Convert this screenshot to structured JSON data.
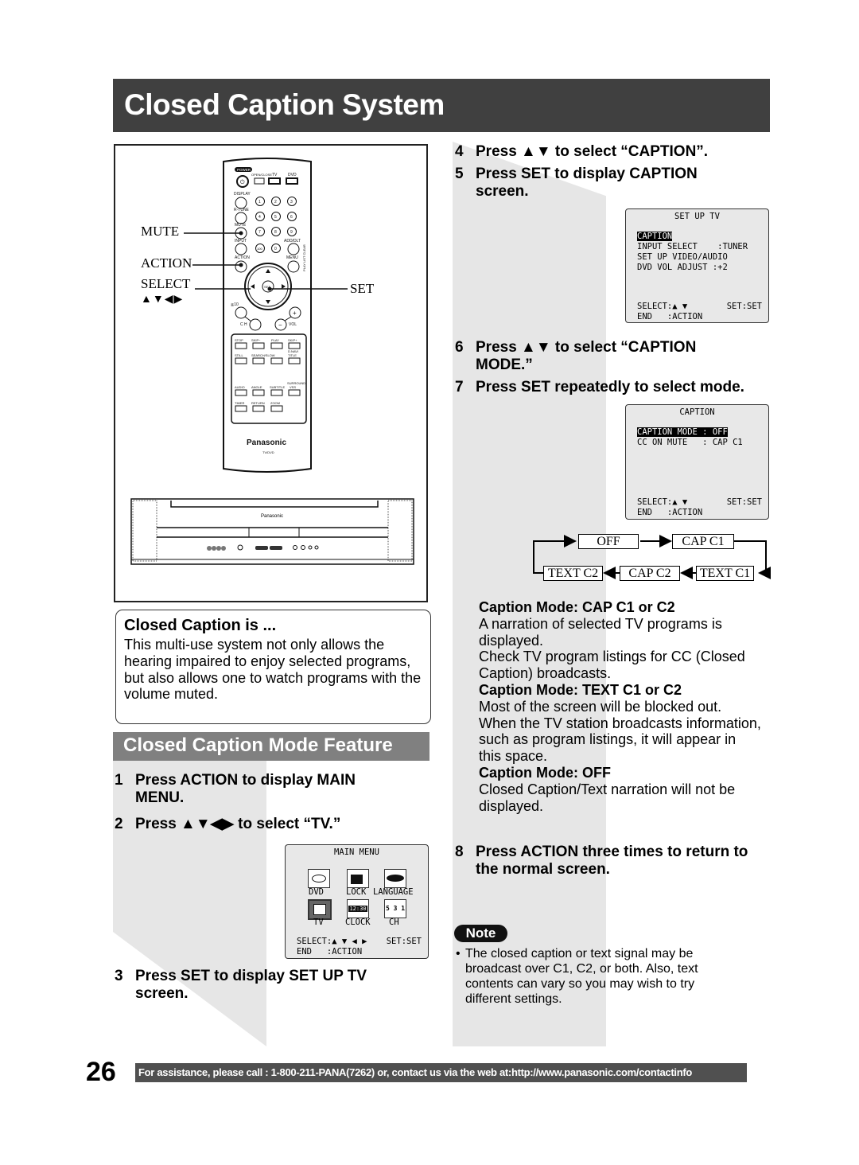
{
  "page": {
    "title": "Closed Caption System",
    "page_number": "26",
    "footer": "For assistance, please call : 1-800-211-PANA(7262) or, contact us via the web at:http://www.panasonic.com/contactinfo"
  },
  "remote": {
    "brand": "Panasonic",
    "model_label": "TV/DVD",
    "callouts": {
      "mute": "MUTE",
      "action": "ACTION",
      "select": "SELECT",
      "select_arrows": "▲▼◀▶",
      "set": "SET"
    },
    "button_labels": {
      "power": "POWER",
      "open_close": "OPEN/CLOSE",
      "tv": "TV",
      "dvd": "DVD",
      "display": "DISPLAY",
      "rtune": "R-TUNE",
      "mute": "MUTE",
      "input": "INPUT",
      "add_dlt": "ADD/DLT",
      "action": "ACTION",
      "menu": "MENU",
      "clear": "CLEAR",
      "play_list": "PLAY LIST",
      "set": "SET",
      "ch": "CH",
      "vol": "VOL",
      "ge10": "≧10",
      "digits": [
        "1",
        "2",
        "3",
        "4",
        "5",
        "6",
        "7",
        "8",
        "9",
        "100",
        "0"
      ],
      "transport_row1": [
        "STOP",
        "SKIP−",
        "PLAY",
        "SKIP+"
      ],
      "transport_row2": [
        "STILL",
        "SEARCH/SLOW",
        "",
        "D.NAVI TITLE"
      ],
      "transport_row3": [
        "AUDIO",
        "ANGLE",
        "SUBTITLE",
        "SURROUND VSS"
      ],
      "transport_row4": [
        "TIMER",
        "RETURN",
        "ZOOM"
      ]
    },
    "tv_brand": "Panasonic"
  },
  "info": {
    "heading": "Closed Caption is ...",
    "body": "This multi-use system not only allows the hearing impaired to enjoy selected programs, but also allows one to watch programs with the volume muted."
  },
  "mode_feature": {
    "heading": "Closed Caption Mode Feature"
  },
  "steps": [
    {
      "num": "1",
      "text": "Press ACTION to display MAIN MENU."
    },
    {
      "num": "2",
      "text": "Press ▲▼◀▶ to select “TV.”"
    },
    {
      "num": "3",
      "text": "Press SET to display SET UP TV screen."
    },
    {
      "num": "4",
      "text": "Press ▲▼ to select “CAPTION”."
    },
    {
      "num": "5",
      "text": "Press SET to display CAPTION screen."
    },
    {
      "num": "6",
      "text": "Press ▲▼ to select “CAPTION MODE.”"
    },
    {
      "num": "7",
      "text": "Press SET repeatedly to select mode."
    },
    {
      "num": "8",
      "text": "Press ACTION three times to return to the normal screen."
    }
  ],
  "main_menu_osd": {
    "title": "MAIN MENU",
    "items": [
      {
        "label": "DVD",
        "icon": "disc-icon"
      },
      {
        "label": "LOCK",
        "icon": "lock-icon"
      },
      {
        "label": "LANGUAGE",
        "icon": "lips-icon"
      },
      {
        "label": "TV",
        "icon": "tv-icon",
        "selected": true
      },
      {
        "label": "CLOCK",
        "icon": "clock-icon",
        "icon_text": "12:30"
      },
      {
        "label": "CH",
        "icon": "channel-icon",
        "icon_text": "5 3 1"
      }
    ],
    "select_hint": "SELECT:▲ ▼ ◀ ▶",
    "set_hint": "SET:SET",
    "end_hint": "END   :ACTION"
  },
  "setup_tv_osd": {
    "title": "SET UP TV",
    "rows": [
      {
        "text": "CAPTION",
        "selected": true
      },
      {
        "text": "INPUT SELECT    :TUNER"
      },
      {
        "text": "SET UP VIDEO/AUDIO"
      },
      {
        "text": "DVD VOL ADJUST :+2"
      }
    ],
    "select_hint": "SELECT:▲ ▼",
    "set_hint": "SET:SET",
    "end_hint": "END   :ACTION"
  },
  "caption_osd": {
    "title": "CAPTION",
    "rows": [
      {
        "text": "CAPTION MODE : OFF",
        "selected": true
      },
      {
        "text": "CC ON MUTE   : CAP C1"
      }
    ],
    "select_hint": "SELECT:▲ ▼",
    "set_hint": "SET:SET",
    "end_hint": "END   :ACTION"
  },
  "mode_cycle": [
    "OFF",
    "CAP C1",
    "TEXT C1",
    "CAP C2",
    "TEXT C2"
  ],
  "mode_descriptions": [
    {
      "heading": "Caption Mode: CAP C1 or C2",
      "text": "A narration of selected TV programs is displayed.\nCheck TV program listings for CC (Closed Caption) broadcasts."
    },
    {
      "heading": "Caption Mode: TEXT C1 or C2",
      "text": "Most of the screen will be blocked out. When the TV station broadcasts information, such as program listings, it will appear in this space."
    },
    {
      "heading": "Caption Mode: OFF",
      "text": "Closed Caption/Text narration will not be displayed."
    }
  ],
  "note": {
    "label": "Note",
    "text": "The closed caption or text signal may be broadcast over C1, C2, or both. Also, text contents can vary so you may wish to try different settings."
  }
}
